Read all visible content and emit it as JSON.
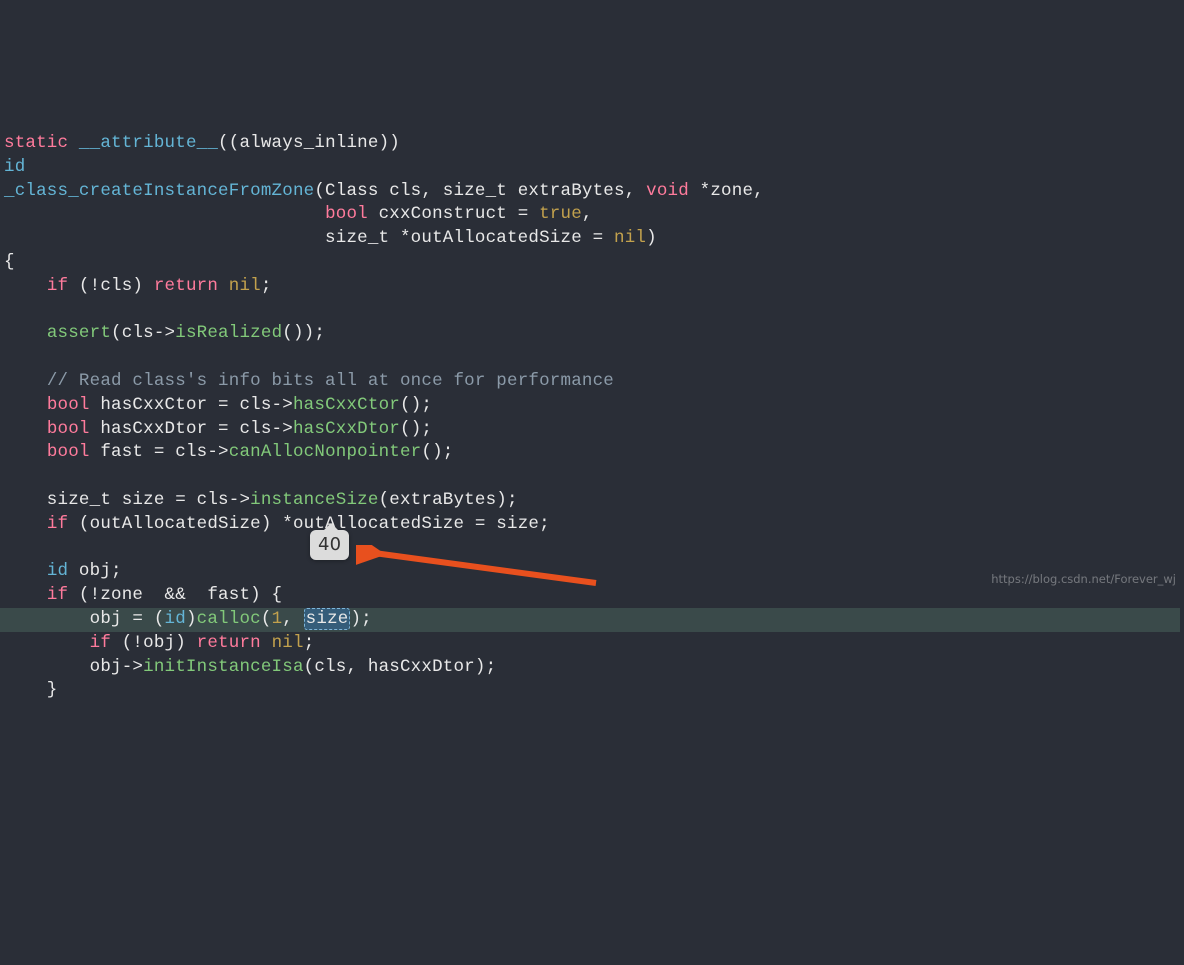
{
  "code": {
    "l1a": "static",
    "l1b": " __attribute__",
    "l1c": "((always_inline))",
    "l2": "id",
    "l3a": "_class_createInstanceFromZone",
    "l3b": "(Class cls, size_t extraBytes, ",
    "l3c": "void",
    "l3d": " *zone,",
    "l4a": "                              ",
    "l4b": "bool",
    "l4c": " cxxConstruct = ",
    "l4d": "true",
    "l4e": ",",
    "l5a": "                              size_t *outAllocatedSize = ",
    "l5b": "nil",
    "l5c": ")",
    "l6": "{",
    "l7a": "    ",
    "l7b": "if",
    "l7c": " (!cls) ",
    "l7d": "return",
    "l7e": " ",
    "l7f": "nil",
    "l7g": ";",
    "l8": "",
    "l9a": "    ",
    "l9b": "assert",
    "l9c": "(cls->",
    "l9d": "isRealized",
    "l9e": "());",
    "l10": "",
    "l11a": "    ",
    "l11b": "// Read class's info bits all at once for performance",
    "l12a": "    ",
    "l12b": "bool",
    "l12c": " hasCxxCtor = cls->",
    "l12d": "hasCxxCtor",
    "l12e": "();",
    "l13a": "    ",
    "l13b": "bool",
    "l13c": " hasCxxDtor = cls->",
    "l13d": "hasCxxDtor",
    "l13e": "();",
    "l14a": "    ",
    "l14b": "bool",
    "l14c": " fast = cls->",
    "l14d": "canAllocNonpointer",
    "l14e": "();",
    "l15": "",
    "l16a": "    size_t size = cls->",
    "l16b": "instanceSize",
    "l16c": "(extraBytes);",
    "l17a": "    ",
    "l17b": "if",
    "l17c": " (outAllocatedSize) *outAllocatedSize = size;",
    "l18": "",
    "l19a": "    ",
    "l19b": "id",
    "l19c": " obj;",
    "l20a": "    ",
    "l20b": "if",
    "l20c": " (!zone  &&  fast) {",
    "l21a": "        obj = (",
    "l21b": "id",
    "l21c": ")",
    "l21d": "calloc",
    "l21e": "(",
    "l21f": "1",
    "l21g": ", ",
    "l21h": "size",
    "l21i": ");",
    "l22a": "        ",
    "l22b": "if",
    "l22c": " (!obj) ",
    "l22d": "return",
    "l22e": " ",
    "l22f": "nil",
    "l22g": ";",
    "l23a": "        obj->",
    "l23b": "initInstanceIsa",
    "l23c": "(cls, hasCxxDtor);",
    "l24": "    }"
  },
  "tooltip": "40",
  "watermark": "https://blog.csdn.net/Forever_wj"
}
